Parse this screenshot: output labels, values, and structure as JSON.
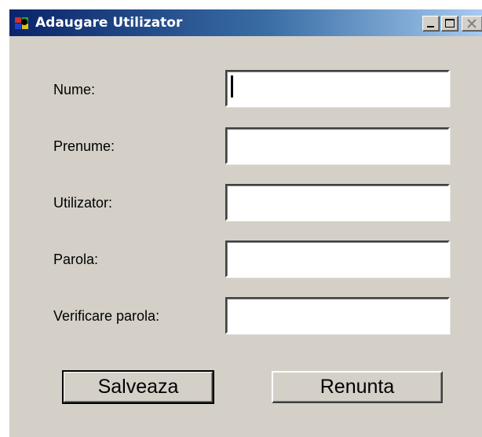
{
  "window": {
    "title": "Adaugare Utilizator",
    "icon": "app-icon",
    "controls": {
      "minimize_icon": "minimize-icon",
      "maximize_icon": "maximize-icon",
      "close_icon": "close-icon"
    },
    "colors": {
      "titlebar_start": "#0a246a",
      "titlebar_end": "#a6caf0",
      "face": "#d4d0c8"
    }
  },
  "form": {
    "fields": [
      {
        "label": "Nume:",
        "value": "",
        "focused": true
      },
      {
        "label": "Prenume:",
        "value": ""
      },
      {
        "label": "Utilizator:",
        "value": ""
      },
      {
        "label": "Parola:",
        "value": ""
      },
      {
        "label": "Verificare parola:",
        "value": ""
      }
    ]
  },
  "buttons": {
    "save_label": "Salveaza",
    "cancel_label": "Renunta"
  }
}
